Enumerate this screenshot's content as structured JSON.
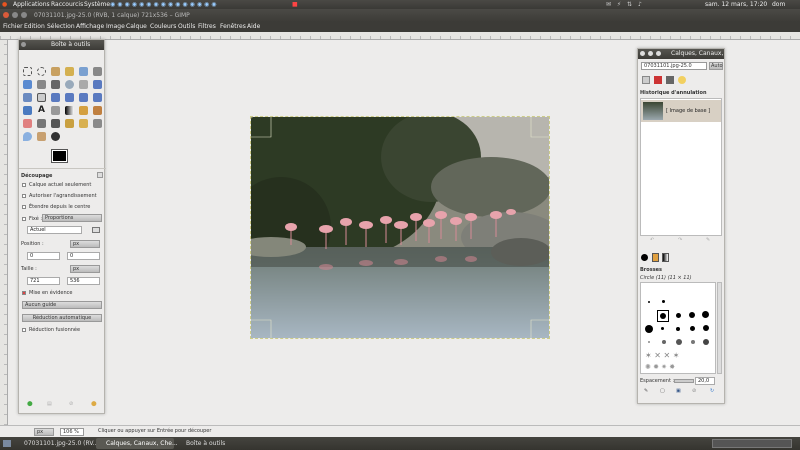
{
  "topbar": {
    "applications": "Applications",
    "shortcuts": "Raccourcis",
    "system": "Système",
    "datetime": "sam. 12 mars, 17:20",
    "user": "dom"
  },
  "window": {
    "title": "07031101.jpg-25.0 (RVB, 1 calque) 721x536 – GIMP"
  },
  "menu": [
    "Fichier",
    "Edition",
    "Sélection",
    "Affichage",
    "Image",
    "Calque",
    "Couleurs",
    "Outils",
    "Filtres",
    "Fenêtres",
    "Aide"
  ],
  "toolbox": {
    "title": "Boîte à outils",
    "section": "Découpage",
    "options": [
      "Calque actuel seulement",
      "Autoriser l'agrandissement",
      "Étendre depuis le centre"
    ],
    "fixed_label": "Fixé :",
    "fixed_combo": "Proportions",
    "aspect_value": "Actuel",
    "position_label": "Position :",
    "position_unit": "px",
    "pos_x": "0",
    "pos_y": "0",
    "size_label": "Taille :",
    "size_unit": "px",
    "size_w": "721",
    "size_h": "536",
    "highlight": "Mise en évidence",
    "guides": "Aucun guide",
    "auto_shrink": "Réduction automatique",
    "merged_shrink": "Réduction fusionnée"
  },
  "layers": {
    "title": "Calques, Canaux, Chemins",
    "image_combo": "07031101.jpg-25.0",
    "auto_label": "Auto",
    "history_title": "Historique d'annulation",
    "history_item": "[ Image de base ]",
    "brushes_title": "Brosses",
    "brush_name": "Circle (11) (11 × 11)",
    "spacing_label": "Espacement :",
    "spacing_value": "20,0"
  },
  "status": {
    "unit": "px",
    "zoom": "106 %",
    "message": "Cliquer ou appuyer sur Entrée pour découper"
  },
  "taskbar": {
    "items": [
      "07031101.jpg-25.0 (RV...",
      "Calques, Canaux, Che...",
      "Boîte à outils"
    ]
  }
}
